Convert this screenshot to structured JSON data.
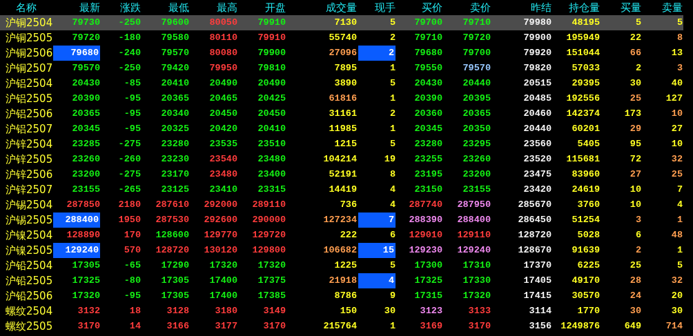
{
  "columns": [
    "名称",
    "最新",
    "涨跌",
    "最低",
    "最高",
    "开盘",
    "成交量",
    "现手",
    "买价",
    "卖价",
    "昨结",
    "持仓量",
    "买量",
    "卖量"
  ],
  "rows": [
    {
      "name": "沪铜2504",
      "selected": true,
      "cells": [
        {
          "text": "79730",
          "color": "#14f014",
          "highlighted": false
        },
        {
          "text": "-250",
          "color": "#14f014",
          "highlighted": false
        },
        {
          "text": "79600",
          "color": "#14f014",
          "highlighted": false
        },
        {
          "text": "80050",
          "color": "#ff3c3c",
          "highlighted": false
        },
        {
          "text": "79910",
          "color": "#14f014",
          "highlighted": false
        },
        {
          "text": "7130",
          "color": "#ffff22",
          "highlighted": false
        },
        {
          "text": "5",
          "color": "#ffff22",
          "highlighted": false
        },
        {
          "text": "79700",
          "color": "#14f014",
          "highlighted": false
        },
        {
          "text": "79710",
          "color": "#14f014",
          "highlighted": false
        },
        {
          "text": "79980",
          "color": "#f4f4f4",
          "highlighted": false
        },
        {
          "text": "48195",
          "color": "#ffff22",
          "highlighted": false
        },
        {
          "text": "5",
          "color": "#ffff22",
          "highlighted": false
        },
        {
          "text": "5",
          "color": "#ffff22",
          "highlighted": false
        }
      ]
    },
    {
      "name": "沪铜2505",
      "selected": false,
      "cells": [
        {
          "text": "79720",
          "color": "#14f014",
          "highlighted": false
        },
        {
          "text": "-180",
          "color": "#14f014",
          "highlighted": false
        },
        {
          "text": "79580",
          "color": "#14f014",
          "highlighted": false
        },
        {
          "text": "80110",
          "color": "#ff3c3c",
          "highlighted": false
        },
        {
          "text": "79910",
          "color": "#ff3c3c",
          "highlighted": false
        },
        {
          "text": "55740",
          "color": "#ffff22",
          "highlighted": false
        },
        {
          "text": "2",
          "color": "#ffff22",
          "highlighted": false
        },
        {
          "text": "79710",
          "color": "#14f014",
          "highlighted": false
        },
        {
          "text": "79720",
          "color": "#14f014",
          "highlighted": false
        },
        {
          "text": "79900",
          "color": "#f4f4f4",
          "highlighted": false
        },
        {
          "text": "195949",
          "color": "#ffff22",
          "highlighted": false
        },
        {
          "text": "22",
          "color": "#ffff22",
          "highlighted": false
        },
        {
          "text": "8",
          "color": "#ff9e50",
          "highlighted": false
        }
      ]
    },
    {
      "name": "沪铜2506",
      "selected": false,
      "cells": [
        {
          "text": "79680",
          "color": "#ffffff",
          "highlighted": true
        },
        {
          "text": "-240",
          "color": "#14f014",
          "highlighted": false
        },
        {
          "text": "79570",
          "color": "#14f014",
          "highlighted": false
        },
        {
          "text": "80080",
          "color": "#ff3c3c",
          "highlighted": false
        },
        {
          "text": "79900",
          "color": "#14f014",
          "highlighted": false
        },
        {
          "text": "27096",
          "color": "#ff9e50",
          "highlighted": false
        },
        {
          "text": "2",
          "color": "#ffffff",
          "highlighted": true
        },
        {
          "text": "79680",
          "color": "#14f014",
          "highlighted": false
        },
        {
          "text": "79700",
          "color": "#14f014",
          "highlighted": false
        },
        {
          "text": "79920",
          "color": "#f4f4f4",
          "highlighted": false
        },
        {
          "text": "151044",
          "color": "#ffff22",
          "highlighted": false
        },
        {
          "text": "66",
          "color": "#ff9e50",
          "highlighted": false
        },
        {
          "text": "13",
          "color": "#ffff22",
          "highlighted": false
        }
      ]
    },
    {
      "name": "沪铜2507",
      "selected": false,
      "cells": [
        {
          "text": "79570",
          "color": "#14f014",
          "highlighted": false
        },
        {
          "text": "-250",
          "color": "#14f014",
          "highlighted": false
        },
        {
          "text": "79420",
          "color": "#14f014",
          "highlighted": false
        },
        {
          "text": "79950",
          "color": "#ff3c3c",
          "highlighted": false
        },
        {
          "text": "79810",
          "color": "#14f014",
          "highlighted": false
        },
        {
          "text": "7895",
          "color": "#ffff22",
          "highlighted": false
        },
        {
          "text": "1",
          "color": "#ffff22",
          "highlighted": false
        },
        {
          "text": "79550",
          "color": "#14f014",
          "highlighted": false
        },
        {
          "text": "79570",
          "color": "#98c8ff",
          "highlighted": false
        },
        {
          "text": "79820",
          "color": "#f4f4f4",
          "highlighted": false
        },
        {
          "text": "57033",
          "color": "#ffff22",
          "highlighted": false
        },
        {
          "text": "2",
          "color": "#ffff22",
          "highlighted": false
        },
        {
          "text": "3",
          "color": "#ff9e50",
          "highlighted": false
        }
      ]
    },
    {
      "name": "沪铝2504",
      "selected": false,
      "cells": [
        {
          "text": "20430",
          "color": "#14f014",
          "highlighted": false
        },
        {
          "text": "-85",
          "color": "#14f014",
          "highlighted": false
        },
        {
          "text": "20410",
          "color": "#14f014",
          "highlighted": false
        },
        {
          "text": "20490",
          "color": "#14f014",
          "highlighted": false
        },
        {
          "text": "20490",
          "color": "#14f014",
          "highlighted": false
        },
        {
          "text": "3890",
          "color": "#ffff22",
          "highlighted": false
        },
        {
          "text": "5",
          "color": "#ffff22",
          "highlighted": false
        },
        {
          "text": "20430",
          "color": "#14f014",
          "highlighted": false
        },
        {
          "text": "20440",
          "color": "#14f014",
          "highlighted": false
        },
        {
          "text": "20515",
          "color": "#f4f4f4",
          "highlighted": false
        },
        {
          "text": "29395",
          "color": "#ffff22",
          "highlighted": false
        },
        {
          "text": "30",
          "color": "#ffff22",
          "highlighted": false
        },
        {
          "text": "40",
          "color": "#ffff22",
          "highlighted": false
        }
      ]
    },
    {
      "name": "沪铝2505",
      "selected": false,
      "cells": [
        {
          "text": "20390",
          "color": "#14f014",
          "highlighted": false
        },
        {
          "text": "-95",
          "color": "#14f014",
          "highlighted": false
        },
        {
          "text": "20365",
          "color": "#14f014",
          "highlighted": false
        },
        {
          "text": "20465",
          "color": "#14f014",
          "highlighted": false
        },
        {
          "text": "20425",
          "color": "#14f014",
          "highlighted": false
        },
        {
          "text": "61816",
          "color": "#ff9e50",
          "highlighted": false
        },
        {
          "text": "1",
          "color": "#ffff22",
          "highlighted": false
        },
        {
          "text": "20390",
          "color": "#14f014",
          "highlighted": false
        },
        {
          "text": "20395",
          "color": "#14f014",
          "highlighted": false
        },
        {
          "text": "20485",
          "color": "#f4f4f4",
          "highlighted": false
        },
        {
          "text": "192556",
          "color": "#ffff22",
          "highlighted": false
        },
        {
          "text": "25",
          "color": "#ff9e50",
          "highlighted": false
        },
        {
          "text": "127",
          "color": "#ffff22",
          "highlighted": false
        }
      ]
    },
    {
      "name": "沪铝2506",
      "selected": false,
      "cells": [
        {
          "text": "20365",
          "color": "#14f014",
          "highlighted": false
        },
        {
          "text": "-95",
          "color": "#14f014",
          "highlighted": false
        },
        {
          "text": "20340",
          "color": "#14f014",
          "highlighted": false
        },
        {
          "text": "20450",
          "color": "#14f014",
          "highlighted": false
        },
        {
          "text": "20450",
          "color": "#14f014",
          "highlighted": false
        },
        {
          "text": "31161",
          "color": "#ffff22",
          "highlighted": false
        },
        {
          "text": "2",
          "color": "#ffff22",
          "highlighted": false
        },
        {
          "text": "20360",
          "color": "#14f014",
          "highlighted": false
        },
        {
          "text": "20365",
          "color": "#14f014",
          "highlighted": false
        },
        {
          "text": "20460",
          "color": "#f4f4f4",
          "highlighted": false
        },
        {
          "text": "142374",
          "color": "#ffff22",
          "highlighted": false
        },
        {
          "text": "173",
          "color": "#ffff22",
          "highlighted": false
        },
        {
          "text": "10",
          "color": "#ff9e50",
          "highlighted": false
        }
      ]
    },
    {
      "name": "沪铝2507",
      "selected": false,
      "cells": [
        {
          "text": "20345",
          "color": "#14f014",
          "highlighted": false
        },
        {
          "text": "-95",
          "color": "#14f014",
          "highlighted": false
        },
        {
          "text": "20325",
          "color": "#14f014",
          "highlighted": false
        },
        {
          "text": "20420",
          "color": "#14f014",
          "highlighted": false
        },
        {
          "text": "20410",
          "color": "#14f014",
          "highlighted": false
        },
        {
          "text": "11985",
          "color": "#ffff22",
          "highlighted": false
        },
        {
          "text": "1",
          "color": "#ffff22",
          "highlighted": false
        },
        {
          "text": "20345",
          "color": "#14f014",
          "highlighted": false
        },
        {
          "text": "20350",
          "color": "#14f014",
          "highlighted": false
        },
        {
          "text": "20440",
          "color": "#f4f4f4",
          "highlighted": false
        },
        {
          "text": "60201",
          "color": "#ffff22",
          "highlighted": false
        },
        {
          "text": "29",
          "color": "#ff9e50",
          "highlighted": false
        },
        {
          "text": "27",
          "color": "#ffff22",
          "highlighted": false
        }
      ]
    },
    {
      "name": "沪锌2504",
      "selected": false,
      "cells": [
        {
          "text": "23285",
          "color": "#14f014",
          "highlighted": false
        },
        {
          "text": "-275",
          "color": "#14f014",
          "highlighted": false
        },
        {
          "text": "23280",
          "color": "#14f014",
          "highlighted": false
        },
        {
          "text": "23535",
          "color": "#14f014",
          "highlighted": false
        },
        {
          "text": "23510",
          "color": "#14f014",
          "highlighted": false
        },
        {
          "text": "1215",
          "color": "#ffff22",
          "highlighted": false
        },
        {
          "text": "5",
          "color": "#ffff22",
          "highlighted": false
        },
        {
          "text": "23280",
          "color": "#14f014",
          "highlighted": false
        },
        {
          "text": "23295",
          "color": "#14f014",
          "highlighted": false
        },
        {
          "text": "23560",
          "color": "#f4f4f4",
          "highlighted": false
        },
        {
          "text": "5405",
          "color": "#ffff22",
          "highlighted": false
        },
        {
          "text": "95",
          "color": "#ffff22",
          "highlighted": false
        },
        {
          "text": "10",
          "color": "#ffff22",
          "highlighted": false
        }
      ]
    },
    {
      "name": "沪锌2505",
      "selected": false,
      "cells": [
        {
          "text": "23260",
          "color": "#14f014",
          "highlighted": false
        },
        {
          "text": "-260",
          "color": "#14f014",
          "highlighted": false
        },
        {
          "text": "23230",
          "color": "#14f014",
          "highlighted": false
        },
        {
          "text": "23540",
          "color": "#ff3c3c",
          "highlighted": false
        },
        {
          "text": "23480",
          "color": "#14f014",
          "highlighted": false
        },
        {
          "text": "104214",
          "color": "#ffff22",
          "highlighted": false
        },
        {
          "text": "19",
          "color": "#ffff22",
          "highlighted": false
        },
        {
          "text": "23255",
          "color": "#14f014",
          "highlighted": false
        },
        {
          "text": "23260",
          "color": "#14f014",
          "highlighted": false
        },
        {
          "text": "23520",
          "color": "#f4f4f4",
          "highlighted": false
        },
        {
          "text": "115681",
          "color": "#ffff22",
          "highlighted": false
        },
        {
          "text": "72",
          "color": "#ffff22",
          "highlighted": false
        },
        {
          "text": "32",
          "color": "#ff9e50",
          "highlighted": false
        }
      ]
    },
    {
      "name": "沪锌2506",
      "selected": false,
      "cells": [
        {
          "text": "23200",
          "color": "#14f014",
          "highlighted": false
        },
        {
          "text": "-275",
          "color": "#14f014",
          "highlighted": false
        },
        {
          "text": "23170",
          "color": "#14f014",
          "highlighted": false
        },
        {
          "text": "23480",
          "color": "#ff3c3c",
          "highlighted": false
        },
        {
          "text": "23400",
          "color": "#14f014",
          "highlighted": false
        },
        {
          "text": "52191",
          "color": "#ffff22",
          "highlighted": false
        },
        {
          "text": "8",
          "color": "#ffff22",
          "highlighted": false
        },
        {
          "text": "23195",
          "color": "#14f014",
          "highlighted": false
        },
        {
          "text": "23200",
          "color": "#14f014",
          "highlighted": false
        },
        {
          "text": "23475",
          "color": "#f4f4f4",
          "highlighted": false
        },
        {
          "text": "83960",
          "color": "#ffff22",
          "highlighted": false
        },
        {
          "text": "27",
          "color": "#ff9e50",
          "highlighted": false
        },
        {
          "text": "25",
          "color": "#ff9e50",
          "highlighted": false
        }
      ]
    },
    {
      "name": "沪锌2507",
      "selected": false,
      "cells": [
        {
          "text": "23155",
          "color": "#14f014",
          "highlighted": false
        },
        {
          "text": "-265",
          "color": "#14f014",
          "highlighted": false
        },
        {
          "text": "23125",
          "color": "#14f014",
          "highlighted": false
        },
        {
          "text": "23410",
          "color": "#14f014",
          "highlighted": false
        },
        {
          "text": "23315",
          "color": "#14f014",
          "highlighted": false
        },
        {
          "text": "14419",
          "color": "#ffff22",
          "highlighted": false
        },
        {
          "text": "4",
          "color": "#ffff22",
          "highlighted": false
        },
        {
          "text": "23150",
          "color": "#14f014",
          "highlighted": false
        },
        {
          "text": "23155",
          "color": "#14f014",
          "highlighted": false
        },
        {
          "text": "23420",
          "color": "#f4f4f4",
          "highlighted": false
        },
        {
          "text": "24619",
          "color": "#ffff22",
          "highlighted": false
        },
        {
          "text": "10",
          "color": "#ffff22",
          "highlighted": false
        },
        {
          "text": "7",
          "color": "#ffff22",
          "highlighted": false
        }
      ]
    },
    {
      "name": "沪锡2504",
      "selected": false,
      "cells": [
        {
          "text": "287850",
          "color": "#ff3c3c",
          "highlighted": false
        },
        {
          "text": "2180",
          "color": "#ff3c3c",
          "highlighted": false
        },
        {
          "text": "287610",
          "color": "#ff3c3c",
          "highlighted": false
        },
        {
          "text": "292000",
          "color": "#ff3c3c",
          "highlighted": false
        },
        {
          "text": "289110",
          "color": "#ff3c3c",
          "highlighted": false
        },
        {
          "text": "736",
          "color": "#ffff22",
          "highlighted": false
        },
        {
          "text": "4",
          "color": "#ffff22",
          "highlighted": false
        },
        {
          "text": "287740",
          "color": "#ff3c3c",
          "highlighted": false
        },
        {
          "text": "287950",
          "color": "#ee88ee",
          "highlighted": false
        },
        {
          "text": "285670",
          "color": "#f4f4f4",
          "highlighted": false
        },
        {
          "text": "3760",
          "color": "#ffff22",
          "highlighted": false
        },
        {
          "text": "10",
          "color": "#ffff22",
          "highlighted": false
        },
        {
          "text": "4",
          "color": "#ffff22",
          "highlighted": false
        }
      ]
    },
    {
      "name": "沪锡2505",
      "selected": false,
      "cells": [
        {
          "text": "288400",
          "color": "#ffffff",
          "highlighted": true
        },
        {
          "text": "1950",
          "color": "#ff3c3c",
          "highlighted": false
        },
        {
          "text": "287530",
          "color": "#ff3c3c",
          "highlighted": false
        },
        {
          "text": "292600",
          "color": "#ff3c3c",
          "highlighted": false
        },
        {
          "text": "290000",
          "color": "#ff3c3c",
          "highlighted": false
        },
        {
          "text": "127234",
          "color": "#ff9e50",
          "highlighted": false
        },
        {
          "text": "7",
          "color": "#ffffff",
          "highlighted": true
        },
        {
          "text": "288390",
          "color": "#ee88ee",
          "highlighted": false
        },
        {
          "text": "288400",
          "color": "#ee88ee",
          "highlighted": false
        },
        {
          "text": "286450",
          "color": "#f4f4f4",
          "highlighted": false
        },
        {
          "text": "51254",
          "color": "#ffff22",
          "highlighted": false
        },
        {
          "text": "3",
          "color": "#ff9e50",
          "highlighted": false
        },
        {
          "text": "1",
          "color": "#ff9e50",
          "highlighted": false
        }
      ]
    },
    {
      "name": "沪镍2504",
      "selected": false,
      "cells": [
        {
          "text": "128890",
          "color": "#ff3c3c",
          "highlighted": false
        },
        {
          "text": "170",
          "color": "#ff3c3c",
          "highlighted": false
        },
        {
          "text": "128600",
          "color": "#14f014",
          "highlighted": false
        },
        {
          "text": "129770",
          "color": "#ff3c3c",
          "highlighted": false
        },
        {
          "text": "129720",
          "color": "#ff3c3c",
          "highlighted": false
        },
        {
          "text": "222",
          "color": "#ffff22",
          "highlighted": false
        },
        {
          "text": "6",
          "color": "#ffff22",
          "highlighted": false
        },
        {
          "text": "129010",
          "color": "#ff3c3c",
          "highlighted": false
        },
        {
          "text": "129110",
          "color": "#ff3c3c",
          "highlighted": false
        },
        {
          "text": "128720",
          "color": "#f4f4f4",
          "highlighted": false
        },
        {
          "text": "5028",
          "color": "#ffff22",
          "highlighted": false
        },
        {
          "text": "6",
          "color": "#ffff22",
          "highlighted": false
        },
        {
          "text": "48",
          "color": "#ff9e50",
          "highlighted": false
        }
      ]
    },
    {
      "name": "沪镍2505",
      "selected": false,
      "cells": [
        {
          "text": "129240",
          "color": "#ffffff",
          "highlighted": true
        },
        {
          "text": "570",
          "color": "#ff3c3c",
          "highlighted": false
        },
        {
          "text": "128720",
          "color": "#ff3c3c",
          "highlighted": false
        },
        {
          "text": "130120",
          "color": "#ff3c3c",
          "highlighted": false
        },
        {
          "text": "129800",
          "color": "#ff3c3c",
          "highlighted": false
        },
        {
          "text": "106682",
          "color": "#ff9e50",
          "highlighted": false
        },
        {
          "text": "15",
          "color": "#ffffff",
          "highlighted": true
        },
        {
          "text": "129230",
          "color": "#ee88ee",
          "highlighted": false
        },
        {
          "text": "129240",
          "color": "#ee88ee",
          "highlighted": false
        },
        {
          "text": "128670",
          "color": "#f4f4f4",
          "highlighted": false
        },
        {
          "text": "91639",
          "color": "#ffff22",
          "highlighted": false
        },
        {
          "text": "2",
          "color": "#ff9e50",
          "highlighted": false
        },
        {
          "text": "1",
          "color": "#ffff22",
          "highlighted": false
        }
      ]
    },
    {
      "name": "沪铅2504",
      "selected": false,
      "cells": [
        {
          "text": "17305",
          "color": "#14f014",
          "highlighted": false
        },
        {
          "text": "-65",
          "color": "#14f014",
          "highlighted": false
        },
        {
          "text": "17290",
          "color": "#14f014",
          "highlighted": false
        },
        {
          "text": "17320",
          "color": "#14f014",
          "highlighted": false
        },
        {
          "text": "17320",
          "color": "#14f014",
          "highlighted": false
        },
        {
          "text": "1225",
          "color": "#ffff22",
          "highlighted": false
        },
        {
          "text": "5",
          "color": "#ffff22",
          "highlighted": false
        },
        {
          "text": "17300",
          "color": "#14f014",
          "highlighted": false
        },
        {
          "text": "17310",
          "color": "#14f014",
          "highlighted": false
        },
        {
          "text": "17370",
          "color": "#f4f4f4",
          "highlighted": false
        },
        {
          "text": "6225",
          "color": "#ffff22",
          "highlighted": false
        },
        {
          "text": "25",
          "color": "#ffff22",
          "highlighted": false
        },
        {
          "text": "5",
          "color": "#ffff22",
          "highlighted": false
        }
      ]
    },
    {
      "name": "沪铅2505",
      "selected": false,
      "cells": [
        {
          "text": "17325",
          "color": "#14f014",
          "highlighted": false
        },
        {
          "text": "-80",
          "color": "#14f014",
          "highlighted": false
        },
        {
          "text": "17305",
          "color": "#14f014",
          "highlighted": false
        },
        {
          "text": "17400",
          "color": "#14f014",
          "highlighted": false
        },
        {
          "text": "17375",
          "color": "#14f014",
          "highlighted": false
        },
        {
          "text": "21918",
          "color": "#ff9e50",
          "highlighted": false
        },
        {
          "text": "4",
          "color": "#ffffff",
          "highlighted": true
        },
        {
          "text": "17325",
          "color": "#14f014",
          "highlighted": false
        },
        {
          "text": "17330",
          "color": "#14f014",
          "highlighted": false
        },
        {
          "text": "17405",
          "color": "#f4f4f4",
          "highlighted": false
        },
        {
          "text": "49170",
          "color": "#ffff22",
          "highlighted": false
        },
        {
          "text": "28",
          "color": "#ff9e50",
          "highlighted": false
        },
        {
          "text": "32",
          "color": "#ff9e50",
          "highlighted": false
        }
      ]
    },
    {
      "name": "沪铅2506",
      "selected": false,
      "cells": [
        {
          "text": "17320",
          "color": "#14f014",
          "highlighted": false
        },
        {
          "text": "-95",
          "color": "#14f014",
          "highlighted": false
        },
        {
          "text": "17305",
          "color": "#14f014",
          "highlighted": false
        },
        {
          "text": "17400",
          "color": "#14f014",
          "highlighted": false
        },
        {
          "text": "17385",
          "color": "#14f014",
          "highlighted": false
        },
        {
          "text": "8786",
          "color": "#ffff22",
          "highlighted": false
        },
        {
          "text": "9",
          "color": "#ffff22",
          "highlighted": false
        },
        {
          "text": "17315",
          "color": "#14f014",
          "highlighted": false
        },
        {
          "text": "17320",
          "color": "#14f014",
          "highlighted": false
        },
        {
          "text": "17415",
          "color": "#f4f4f4",
          "highlighted": false
        },
        {
          "text": "30570",
          "color": "#ffff22",
          "highlighted": false
        },
        {
          "text": "24",
          "color": "#ff9e50",
          "highlighted": false
        },
        {
          "text": "20",
          "color": "#ffff22",
          "highlighted": false
        }
      ]
    },
    {
      "name": "螺纹2504",
      "selected": false,
      "cells": [
        {
          "text": "3132",
          "color": "#ff3c3c",
          "highlighted": false
        },
        {
          "text": "18",
          "color": "#ff3c3c",
          "highlighted": false
        },
        {
          "text": "3128",
          "color": "#ff3c3c",
          "highlighted": false
        },
        {
          "text": "3180",
          "color": "#ff3c3c",
          "highlighted": false
        },
        {
          "text": "3149",
          "color": "#ff3c3c",
          "highlighted": false
        },
        {
          "text": "150",
          "color": "#ffff22",
          "highlighted": false
        },
        {
          "text": "30",
          "color": "#ffff22",
          "highlighted": false
        },
        {
          "text": "3123",
          "color": "#ee88ee",
          "highlighted": false
        },
        {
          "text": "3133",
          "color": "#ff3c3c",
          "highlighted": false
        },
        {
          "text": "3114",
          "color": "#f4f4f4",
          "highlighted": false
        },
        {
          "text": "1770",
          "color": "#ffff22",
          "highlighted": false
        },
        {
          "text": "30",
          "color": "#ff9e50",
          "highlighted": false
        },
        {
          "text": "30",
          "color": "#ffff22",
          "highlighted": false
        }
      ]
    },
    {
      "name": "螺纹2505",
      "selected": false,
      "cells": [
        {
          "text": "3170",
          "color": "#ff3c3c",
          "highlighted": false
        },
        {
          "text": "14",
          "color": "#ff3c3c",
          "highlighted": false
        },
        {
          "text": "3166",
          "color": "#ff3c3c",
          "highlighted": false
        },
        {
          "text": "3177",
          "color": "#ff3c3c",
          "highlighted": false
        },
        {
          "text": "3170",
          "color": "#ff3c3c",
          "highlighted": false
        },
        {
          "text": "215764",
          "color": "#ffff22",
          "highlighted": false
        },
        {
          "text": "1",
          "color": "#ffff22",
          "highlighted": false
        },
        {
          "text": "3169",
          "color": "#ff3c3c",
          "highlighted": false
        },
        {
          "text": "3170",
          "color": "#ff3c3c",
          "highlighted": false
        },
        {
          "text": "3156",
          "color": "#f4f4f4",
          "highlighted": false
        },
        {
          "text": "1249876",
          "color": "#ffff22",
          "highlighted": false
        },
        {
          "text": "649",
          "color": "#ffff22",
          "highlighted": false
        },
        {
          "text": "714",
          "color": "#ff9e50",
          "highlighted": false
        }
      ]
    }
  ]
}
